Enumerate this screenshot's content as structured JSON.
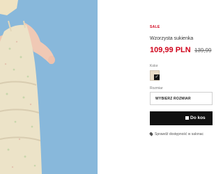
{
  "product": {
    "badge": "SALE",
    "name": "Wzorzysta sukienka",
    "price": "109,99 PLN",
    "old_price": "139,99",
    "color_label": "Kolor",
    "size_label": "Rozmiar",
    "size_select": "WYBIERZ ROZMIAR",
    "cart_button": "Do kos",
    "store_check": "Sprawdź dostępność w salonac"
  },
  "colors": {
    "sale_red": "#d0021b",
    "photo_background": "#7fb2d8",
    "dress": "#ece3c8",
    "button": "#111111"
  },
  "icons": {
    "swatch_check": "check-icon",
    "cart": "cart-icon",
    "store": "location-pin-icon"
  }
}
